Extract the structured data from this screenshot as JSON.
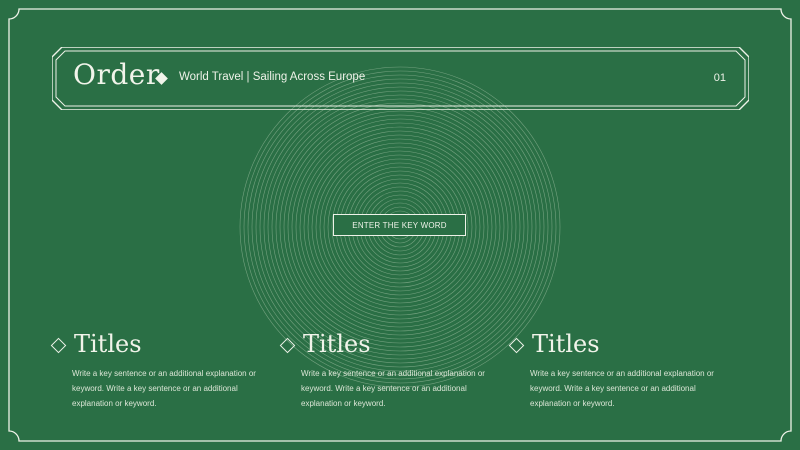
{
  "header": {
    "title": "Order",
    "subtitle": "World Travel | Sailing Across Europe",
    "page_number": "01"
  },
  "keyword_button": {
    "label": "ENTER THE KEY WORD"
  },
  "features": [
    {
      "title": "Titles",
      "description": "Write a key sentence or an additional explanation or keyword. Write a key sentence or an additional explanation or keyword."
    },
    {
      "title": "Titles",
      "description": "Write a key sentence or an additional explanation or keyword. Write a key sentence or an additional explanation or keyword."
    },
    {
      "title": "Titles",
      "description": "Write a key sentence or an additional explanation or keyword. Write a key sentence or an additional explanation or keyword."
    }
  ],
  "colors": {
    "background": "#2a6f45",
    "foreground": "#eef2e8"
  },
  "icons": [
    "diamond-filled-icon",
    "diamond-outline-icon",
    "concentric-rings-decoration"
  ]
}
